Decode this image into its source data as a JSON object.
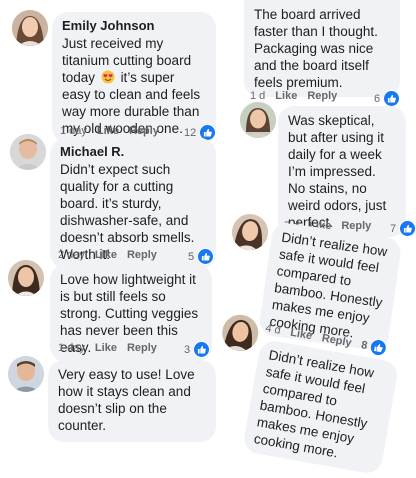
{
  "comments_left": [
    {
      "author": "Emily Johnson",
      "text_before": "Just received my titanium cutting board today",
      "text_emoji": "heart-eyes-emoji",
      "text_after": "it’s super easy to clean and feels way more durable than my old wooden one.",
      "time": "1 day",
      "like_label": "Like",
      "reply_label": "Reply",
      "reaction_count": "12"
    },
    {
      "author": "Michael R.",
      "text": "Didn’t expect such quality for a cutting board. it’s sturdy, dishwasher-safe, and doesn’t absorb smells. Worth it!",
      "time": "2 day",
      "like_label": "Like",
      "reply_label": "Reply",
      "reaction_count": "5"
    },
    {
      "author": "",
      "text": "Love how lightweight it is but still feels so strong. Cutting veggies has never been this easy.",
      "time": "1 day",
      "like_label": "Like",
      "reply_label": "Reply",
      "reaction_count": "3"
    },
    {
      "author": "",
      "text": "Very easy to use! Love how it stays clean and doesn’t slip on the counter.",
      "time": "",
      "like_label": "",
      "reply_label": "",
      "reaction_count": ""
    }
  ],
  "comments_right": [
    {
      "text": "The board arrived faster than I thought. Packaging was nice and the board itself feels premium.",
      "time": "1 d",
      "like_label": "Like",
      "reply_label": "Reply",
      "reaction_count": "6"
    },
    {
      "text": "Was skeptical, but after using it daily for a week I’m impressed. No stains, no weird odors, just perfect.",
      "time": "7 d",
      "like_label": "Like",
      "reply_label": "Reply",
      "reaction_count": "7"
    },
    {
      "text": "Didn’t realize how safe it would feel compared to bamboo. Honestly makes me enjoy cooking more.",
      "time": "4 d",
      "like_label": "Like",
      "reply_label": "Reply",
      "reaction_count": "8"
    },
    {
      "text": "Didn’t realize how safe it would feel compared to bamboo. Honestly makes me enjoy cooking more.",
      "time": "",
      "like_label": "",
      "reply_label": "",
      "reaction_count": ""
    }
  ],
  "colors": {
    "bubble": "#f0f2f5",
    "like_blue": "#1877f2",
    "meta_gray": "#65676b"
  },
  "icons": {
    "reaction": "thumbs-up-icon",
    "avatar": "avatar-photo"
  }
}
